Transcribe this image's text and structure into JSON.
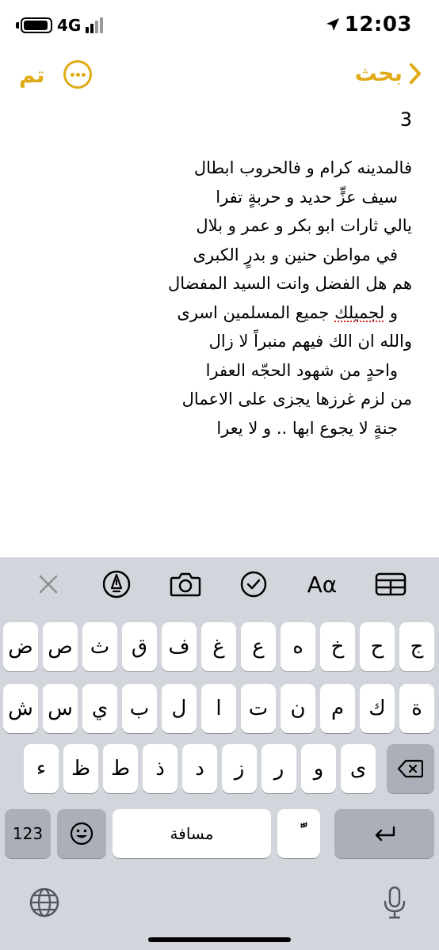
{
  "status_bar": {
    "network": "4G",
    "time": "12:03"
  },
  "nav": {
    "done_label": "تم",
    "back_label": "بحث"
  },
  "note": {
    "title": "3",
    "lines": [
      "فالمدينه كرام و فالحروب ابطال",
      "سيف عزٍّ حديد و حربةٍ تفرا",
      "يالي ثارات ابو بكر و عمر و بلال",
      "في مواطن حنين و بدرٍ الكبرى",
      "هم هل الفضل وانت السيد المفضال",
      "و",
      "لجميلك",
      "جميع المسلمين اسرى",
      "والله ان الك فيهم منبراً لا زال",
      "واحدٍ من شهود الحجّه العفرا",
      "من لزم غرزها يجزى على الاعمال",
      "جنةٍ لا يجوع ابها .. و لا يعرا"
    ]
  },
  "toolbar": {
    "format_label": "Aα"
  },
  "keyboard": {
    "row1": [
      "ج",
      "ح",
      "خ",
      "ه",
      "ع",
      "غ",
      "ف",
      "ق",
      "ث",
      "ص",
      "ض"
    ],
    "row2": [
      "ة",
      "ك",
      "م",
      "ن",
      "ت",
      "ا",
      "ل",
      "ب",
      "ي",
      "س",
      "ش"
    ],
    "row3": [
      "ى",
      "و",
      "ر",
      "ز",
      "د",
      "ذ",
      "ط",
      "ظ",
      "ء"
    ],
    "numbers_label": "123",
    "space_label": "مسافة",
    "diacritic_label": "ًّ"
  },
  "colors": {
    "accent": "#e0ab17",
    "keyboard_bg": "#d2d5db",
    "key_dark": "#abb0b8"
  }
}
